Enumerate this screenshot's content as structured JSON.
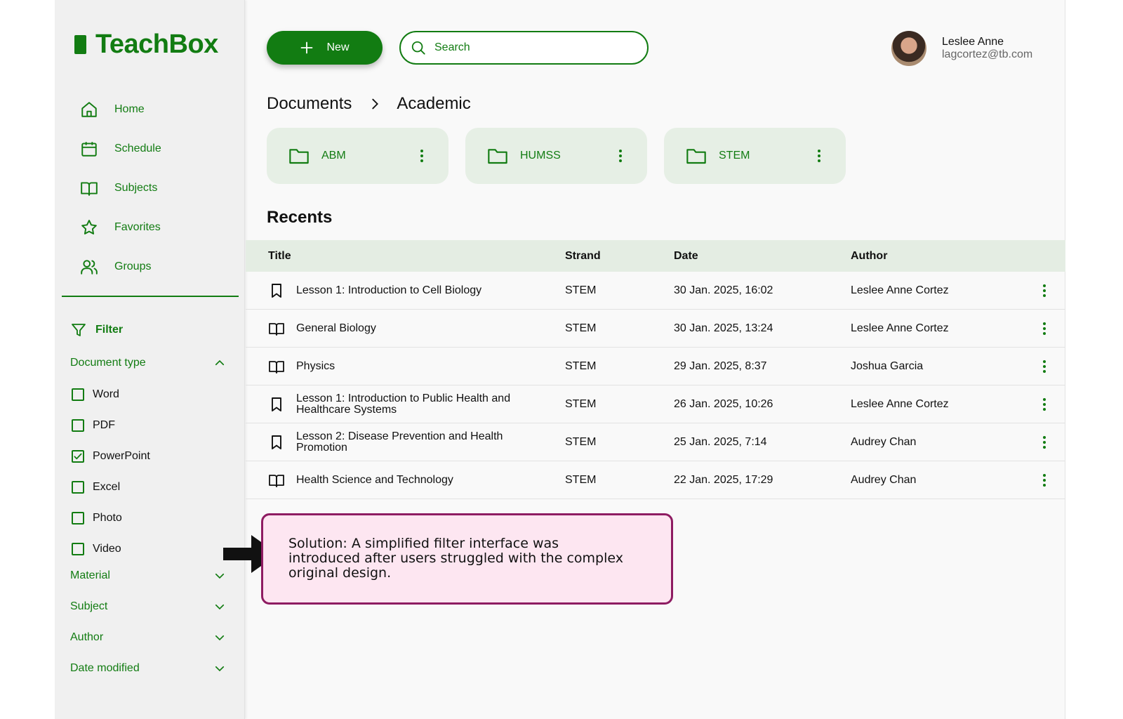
{
  "brand": {
    "name": "TeachBox",
    "color": "#127c12"
  },
  "sidebar": {
    "nav": [
      {
        "label": "Home",
        "icon": "home-icon"
      },
      {
        "label": "Schedule",
        "icon": "calendar-icon"
      },
      {
        "label": "Subjects",
        "icon": "book-icon"
      },
      {
        "label": "Favorites",
        "icon": "star-icon"
      },
      {
        "label": "Groups",
        "icon": "users-icon"
      }
    ],
    "filter": {
      "title": "Filter",
      "document_type": {
        "label": "Document type",
        "options": [
          {
            "label": "Word",
            "checked": false
          },
          {
            "label": "PDF",
            "checked": false
          },
          {
            "label": "PowerPoint",
            "checked": true
          },
          {
            "label": "Excel",
            "checked": false
          },
          {
            "label": "Photo",
            "checked": false
          },
          {
            "label": "Video",
            "checked": false
          }
        ]
      },
      "sections": [
        "Material",
        "Subject",
        "Author",
        "Date modified"
      ]
    }
  },
  "toolbar": {
    "new_label": "New",
    "search_placeholder": "Search"
  },
  "user": {
    "name": "Leslee Anne",
    "email": "lagcortez@tb.com"
  },
  "breadcrumb": [
    "Documents",
    "Academic"
  ],
  "folders": [
    "ABM",
    "HUMSS",
    "STEM"
  ],
  "recents": {
    "title": "Recents",
    "columns": [
      "Title",
      "Strand",
      "Date",
      "Author"
    ],
    "rows": [
      {
        "icon": "bookmark-icon",
        "title_lines": [
          "Lesson 1: Introduction to Cell Biology"
        ],
        "strand": "STEM",
        "date": "30 Jan. 2025, 16:02",
        "author": "Leslee Anne Cortez"
      },
      {
        "icon": "book-open-icon",
        "title_lines": [
          "General Biology"
        ],
        "strand": "STEM",
        "date": "30 Jan. 2025, 13:24",
        "author": "Leslee Anne Cortez"
      },
      {
        "icon": "book-open-icon",
        "title_lines": [
          "Physics"
        ],
        "strand": "STEM",
        "date": "29 Jan. 2025, 8:37",
        "author": "Joshua Garcia"
      },
      {
        "icon": "bookmark-icon",
        "title_lines": [
          "Lesson 1: Introduction to Public Health and",
          "Healthcare Systems"
        ],
        "strand": "STEM",
        "date": "26 Jan. 2025, 10:26",
        "author": "Leslee Anne Cortez"
      },
      {
        "icon": "bookmark-icon",
        "title_lines": [
          "Lesson 2: Disease Prevention and Health",
          "Promotion"
        ],
        "strand": "STEM",
        "date": "25 Jan. 2025, 7:14",
        "author": "Audrey Chan"
      },
      {
        "icon": "book-open-icon",
        "title_lines": [
          "Health Science and Technology"
        ],
        "strand": "STEM",
        "date": "22 Jan. 2025, 17:29",
        "author": "Audrey Chan"
      }
    ]
  },
  "annotation": {
    "lines": [
      "Solution: A simplified filter interface was",
      "introduced after users struggled with the complex",
      "original design."
    ],
    "border_color": "#8e1c62",
    "fill_color": "#fde6f1"
  }
}
